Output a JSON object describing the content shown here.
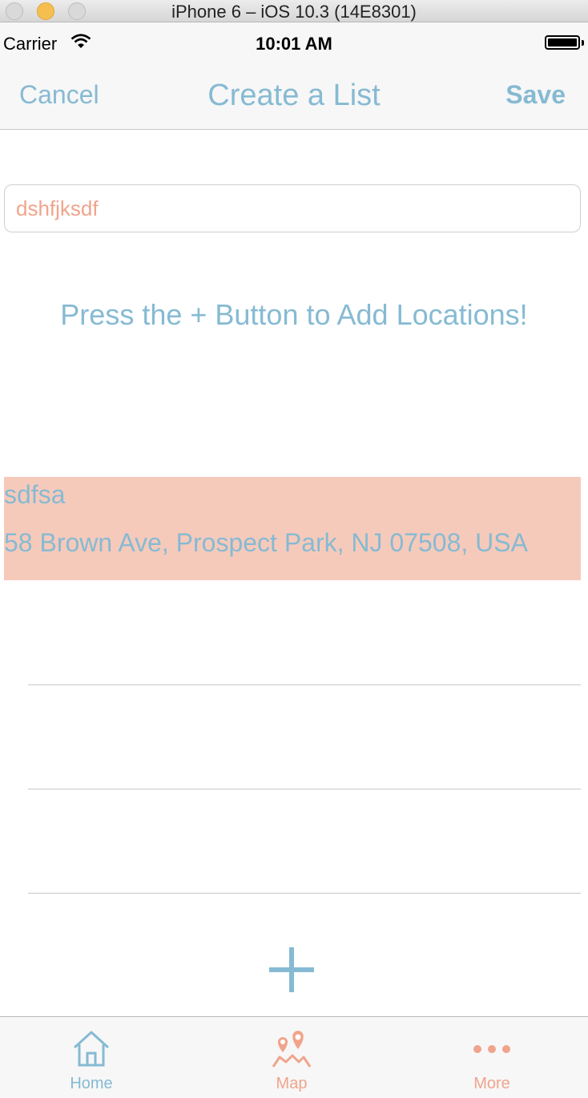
{
  "window": {
    "title": "iPhone 6 – iOS 10.3 (14E8301)"
  },
  "status_bar": {
    "carrier": "Carrier",
    "time": "10:01 AM"
  },
  "nav": {
    "cancel_label": "Cancel",
    "title": "Create a List",
    "save_label": "Save"
  },
  "list_name_field": {
    "value": "dshfjksdf"
  },
  "hint": "Press the + Button to Add Locations!",
  "locations": [
    {
      "name": "sdfsa",
      "address": "58 Brown Ave, Prospect Park, NJ 07508, USA"
    }
  ],
  "add_button": {
    "icon": "plus-icon"
  },
  "tabs": [
    {
      "label": "Home",
      "icon": "home-icon"
    },
    {
      "label": "Map",
      "icon": "map-pin-icon"
    },
    {
      "label": "More",
      "icon": "more-dots-icon"
    }
  ],
  "colors": {
    "accent_blue": "#86bad3",
    "accent_salmon": "#f0a48c",
    "row_highlight": "#f6cabb"
  }
}
